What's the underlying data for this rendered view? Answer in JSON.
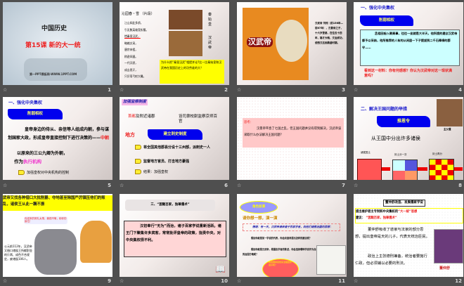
{
  "slides": [
    {
      "num": "1",
      "title": "中国历史",
      "subtitle": "第15课  新的大一统",
      "footer": "第一PPT模板网-WWW.1PPT.COM"
    },
    {
      "num": "2",
      "poem_title": "沁园春・雪 （片段）",
      "poem": [
        "江山如此多娇，",
        "引无数英雄竞折腰。",
        "惜秦皇汉武，",
        "略输文采，",
        "唐宗宋祖，",
        "稍逊风骚。",
        "一代天骄，",
        "成吉思汗，",
        "只识弯弓射大雕。"
      ],
      "label1": "秦始皇",
      "label2": "汉武帝",
      "question": "为什么把“秦皇汉武”相提并论?比一比秦始皇和汉武帝在我国历史上的功劳谁的大？"
    },
    {
      "num": "3",
      "banner": "汉武帝",
      "bio": "汉武帝 刘彻（前156年—前87年），汉景帝之子，十六岁登基，在位五十四年，雄才大略，文治武功，使西汉达到鼎盛时期。"
    },
    {
      "num": "4",
      "heading": "一、强化中央集权",
      "flag": "削弱相权",
      "material": "丞相田蚡入朝奏事，往往一坐就是大半天，他所提的建议汉武帝都予以采纳，他所推荐的人有的从闲居一下子提拔到二千石俸禄的郡守……",
      "question": "看到这一材料：你有何感想？你认为汉武帝对这一现状满意吗？"
    },
    {
      "num": "5",
      "heading": "一、强化中央集权",
      "flag": "削弱相权",
      "text": "皇帝身边的侍从、亲信等人组成内朝，参与谋划国家大政，形成皇帝直接控制下进行决策的——",
      "inner": "中朝",
      "outer": "以原来的三公九卿为外朝，",
      "exec_prefix": "作为",
      "exec": "执行机构",
      "bullet": "加强皇权对中央机构的控制"
    },
    {
      "num": "6",
      "heading": "加强监察制度",
      "capital_a": "首都",
      "capital_b": "及附近诸郡",
      "capital_c": "设司隶校尉监察京师百官",
      "local": "地方",
      "flag": "建立刺史制度",
      "bullets": [
        "将全国其他郡县分设十三州部，派刺史一人",
        "监督地方官员、打击地方豪强",
        "结果：加强皇权"
      ]
    },
    {
      "num": "7",
      "think": "思考：",
      "text": "汉景帝平息了七国之乱，但王国问题并没有得到解决，汉武帝该采取什么办法解决王国问题？"
    },
    {
      "num": "8",
      "heading": "二、解决王国问题的举措",
      "flag": "推恩令",
      "portrait": "主父偃",
      "main": "从王国中分出许多诸侯",
      "l1": "诸侯国土",
      "l2": "封土分一次",
      "l3": "封土再分"
    },
    {
      "num": "9",
      "top": "武帝又找各种借口大批削爵、夺地甚至除国严厉镇压他们的叛乱，诸侯王从此一蹶不振",
      "bubble": "你送来的贺礼太薄，藐视不敬，削你的爵位！",
      "side": "公元前112年，汉武帝又借口诸侯王所献酎金的斤两、成色不合规定，废诸侯106人。"
    },
    {
      "num": "10",
      "heading": "三、“罢黜百家，独尊儒术”",
      "text": "汉初奉行“无为”而治，诸子百家学说重新活跃。诸王门下聚集许多宾客，常常批评皇帝的政策，指责中央，对中央集权很不利。"
    },
    {
      "num": "11",
      "badge": "角色扮演",
      "heading": "请你想一想，演一演",
      "scene": "情境：有一天，汉武帝请来诸子百家学者，向他们请教治国的思想：",
      "q1": "假如你就是某一学说的代表，你会向皇帝提出怎样的建议呢？",
      "q2": "假如你就是汉武帝，根据各学者的陈述，你会选择哪种学说作为自己的治国方略呢？",
      "bubble": "我用哪种思想来治理国家最好呢？"
    },
    {
      "num": "12",
      "heading": "董仲舒改造、发展儒家学说",
      "line1a": "提出维护君主专制和中央集权的",
      "line1b": "“大一统”思想",
      "line2a": "建议：",
      "line2b": "“罢黜百家，独尊儒术”",
      "p1": "董仲舒吸收了道家与法家的部分思想，提出皇帝是天的儿子，代表天统治臣民。",
      "p2": "政治上主张德刑兼备，统治者要施行仁政，但必须辅以必要的刑法。",
      "portrait": "董仲舒"
    }
  ],
  "colors": {
    "red": "#ee2222",
    "blue": "#1a1acc",
    "yellow": "#ffff00"
  }
}
